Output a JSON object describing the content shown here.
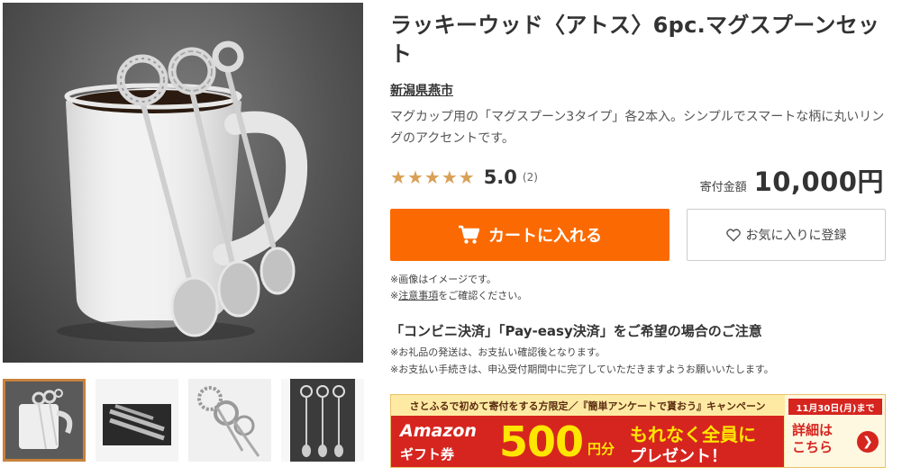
{
  "product": {
    "title": "ラッキーウッド〈アトス〉6pc.マグスプーンセット",
    "region": "新潟県燕市",
    "description": "マグカップ用の「マグスプーン3タイプ」各2本入。シンプルでスマートな柄に丸いリングのアクセントです。",
    "rating": {
      "stars": [
        "★",
        "★",
        "★",
        "★",
        "★"
      ],
      "value": "5.0",
      "count": "(2)"
    },
    "price": {
      "label": "寄付金額",
      "value": "10,000円"
    }
  },
  "gallery": {
    "thumbnail_count": 4,
    "selected_index": 0
  },
  "actions": {
    "cart_label": "カートに入れる",
    "favorite_label": "お気に入りに登録"
  },
  "notes": {
    "line1": "※画像はイメージです。",
    "line2_prefix": "※",
    "line2_link": "注意事項",
    "line2_suffix": "をご確認ください。"
  },
  "payment_notice": {
    "title": "「コンビニ決済」「Pay-easy決済」をご希望の場合のご注意",
    "line1": "※お礼品の発送は、お支払い確認後となります。",
    "line2": "※お支払い手続きは、申込受付期間中に完了していただきますようお願いいたします。"
  },
  "banner": {
    "top_text": "さとふるで初めて寄付をする方限定／『簡単アンケートで貰おう』キャンペーン",
    "amazon": "Amazon",
    "gift": "ギフト券",
    "amount": "500",
    "unit": "円分",
    "line1": "もれなく全員に",
    "line2": "プレゼント！",
    "date": "11月30日(月)まで",
    "detail": "詳細は こちら",
    "arrow": "❯"
  },
  "colors": {
    "accent": "#fb6a02",
    "star": "#d9a056",
    "banner_red": "#d6251f",
    "banner_yellow": "#ffe600"
  },
  "icons": {
    "cart": "cart-icon",
    "heart": "heart-outline-icon",
    "star": "star-icon"
  }
}
